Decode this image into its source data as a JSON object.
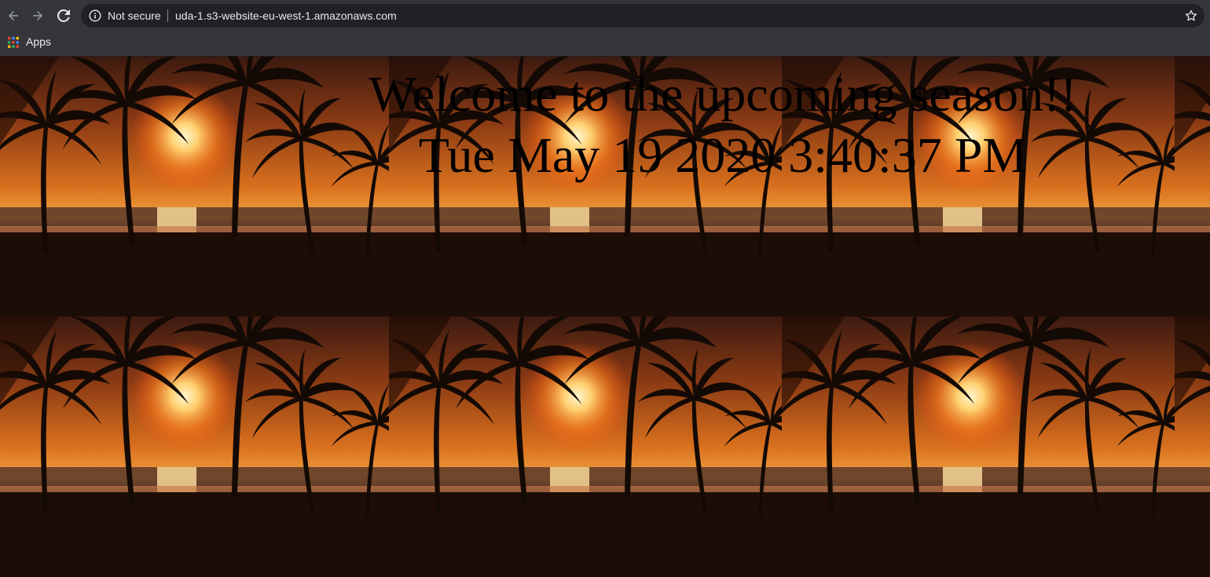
{
  "browser": {
    "security_label": "Not secure",
    "url": "uda-1.s3-website-eu-west-1.amazonaws.com",
    "bookmarks": [
      {
        "label": "Apps",
        "icon": "apps-grid-icon"
      }
    ],
    "icons": [
      "back-arrow-icon",
      "forward-arrow-icon",
      "reload-icon",
      "info-icon",
      "bookmark-star-icon"
    ],
    "colors": {
      "chrome": "#35363a",
      "omnibox": "#202124",
      "text": "#e8eaed"
    }
  },
  "page": {
    "title": "Welcome to the upcoming season!!",
    "clock": "Tue May 19 2020 3:40:37 PM",
    "background": "tiled tropical sunset with palm trees"
  }
}
